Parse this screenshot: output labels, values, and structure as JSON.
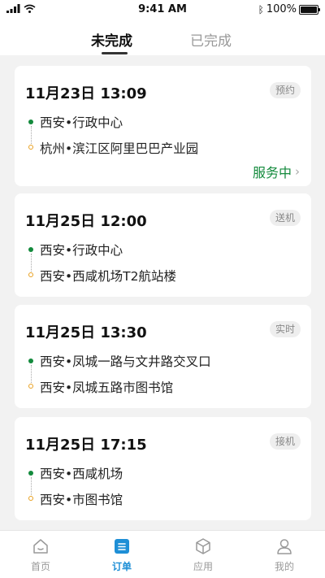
{
  "status_bar": {
    "time": "9:41 AM",
    "battery": "100%",
    "battery_level": 1.0
  },
  "tabs": [
    {
      "label": "未完成",
      "active": true
    },
    {
      "label": "已完成",
      "active": false
    }
  ],
  "orders": [
    {
      "time": "11月23日 13:09",
      "tag": "预约",
      "from": "西安•行政中心",
      "to": "杭州•滨江区阿里巴巴产业园",
      "status": "服务中"
    },
    {
      "time": "11月25日 12:00",
      "tag": "送机",
      "from": "西安•行政中心",
      "to": "西安•西咸机场T2航站楼"
    },
    {
      "time": "11月25日 13:30",
      "tag": "实时",
      "from": "西安•凤城一路与文井路交叉口",
      "to": "西安•凤城五路市图书馆"
    },
    {
      "time": "11月25日 17:15",
      "tag": "接机",
      "from": "西安•西咸机场",
      "to": "西安•市图书馆"
    }
  ],
  "colors": {
    "accent_green": "#138a3c",
    "nav_active": "#1e8fd6",
    "origin_dot": "#138a3c",
    "destination_dot": "#e8a020"
  },
  "bottom_nav": [
    {
      "label": "首页",
      "icon": "home-icon",
      "active": false
    },
    {
      "label": "订单",
      "icon": "order-icon",
      "active": true
    },
    {
      "label": "应用",
      "icon": "cube-icon",
      "active": false
    },
    {
      "label": "我的",
      "icon": "user-icon",
      "active": false
    }
  ]
}
